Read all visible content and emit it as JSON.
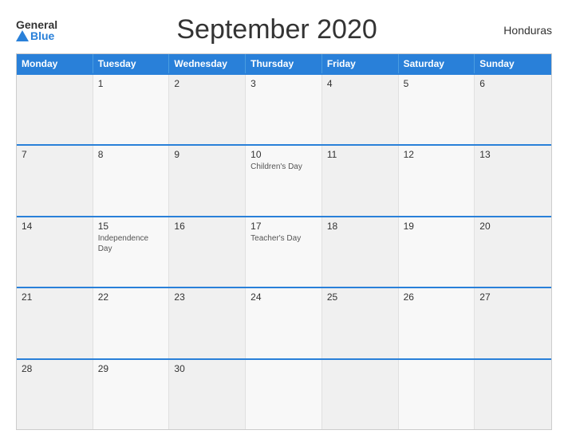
{
  "header": {
    "logo_general": "General",
    "logo_blue": "Blue",
    "title": "September 2020",
    "country": "Honduras"
  },
  "calendar": {
    "days_of_week": [
      "Monday",
      "Tuesday",
      "Wednesday",
      "Thursday",
      "Friday",
      "Saturday",
      "Sunday"
    ],
    "weeks": [
      [
        {
          "num": "",
          "event": ""
        },
        {
          "num": "1",
          "event": ""
        },
        {
          "num": "2",
          "event": ""
        },
        {
          "num": "3",
          "event": ""
        },
        {
          "num": "4",
          "event": ""
        },
        {
          "num": "5",
          "event": ""
        },
        {
          "num": "6",
          "event": ""
        }
      ],
      [
        {
          "num": "7",
          "event": ""
        },
        {
          "num": "8",
          "event": ""
        },
        {
          "num": "9",
          "event": ""
        },
        {
          "num": "10",
          "event": "Children's Day"
        },
        {
          "num": "11",
          "event": ""
        },
        {
          "num": "12",
          "event": ""
        },
        {
          "num": "13",
          "event": ""
        }
      ],
      [
        {
          "num": "14",
          "event": ""
        },
        {
          "num": "15",
          "event": "Independence Day"
        },
        {
          "num": "16",
          "event": ""
        },
        {
          "num": "17",
          "event": "Teacher's Day"
        },
        {
          "num": "18",
          "event": ""
        },
        {
          "num": "19",
          "event": ""
        },
        {
          "num": "20",
          "event": ""
        }
      ],
      [
        {
          "num": "21",
          "event": ""
        },
        {
          "num": "22",
          "event": ""
        },
        {
          "num": "23",
          "event": ""
        },
        {
          "num": "24",
          "event": ""
        },
        {
          "num": "25",
          "event": ""
        },
        {
          "num": "26",
          "event": ""
        },
        {
          "num": "27",
          "event": ""
        }
      ],
      [
        {
          "num": "28",
          "event": ""
        },
        {
          "num": "29",
          "event": ""
        },
        {
          "num": "30",
          "event": ""
        },
        {
          "num": "",
          "event": ""
        },
        {
          "num": "",
          "event": ""
        },
        {
          "num": "",
          "event": ""
        },
        {
          "num": "",
          "event": ""
        }
      ]
    ]
  }
}
